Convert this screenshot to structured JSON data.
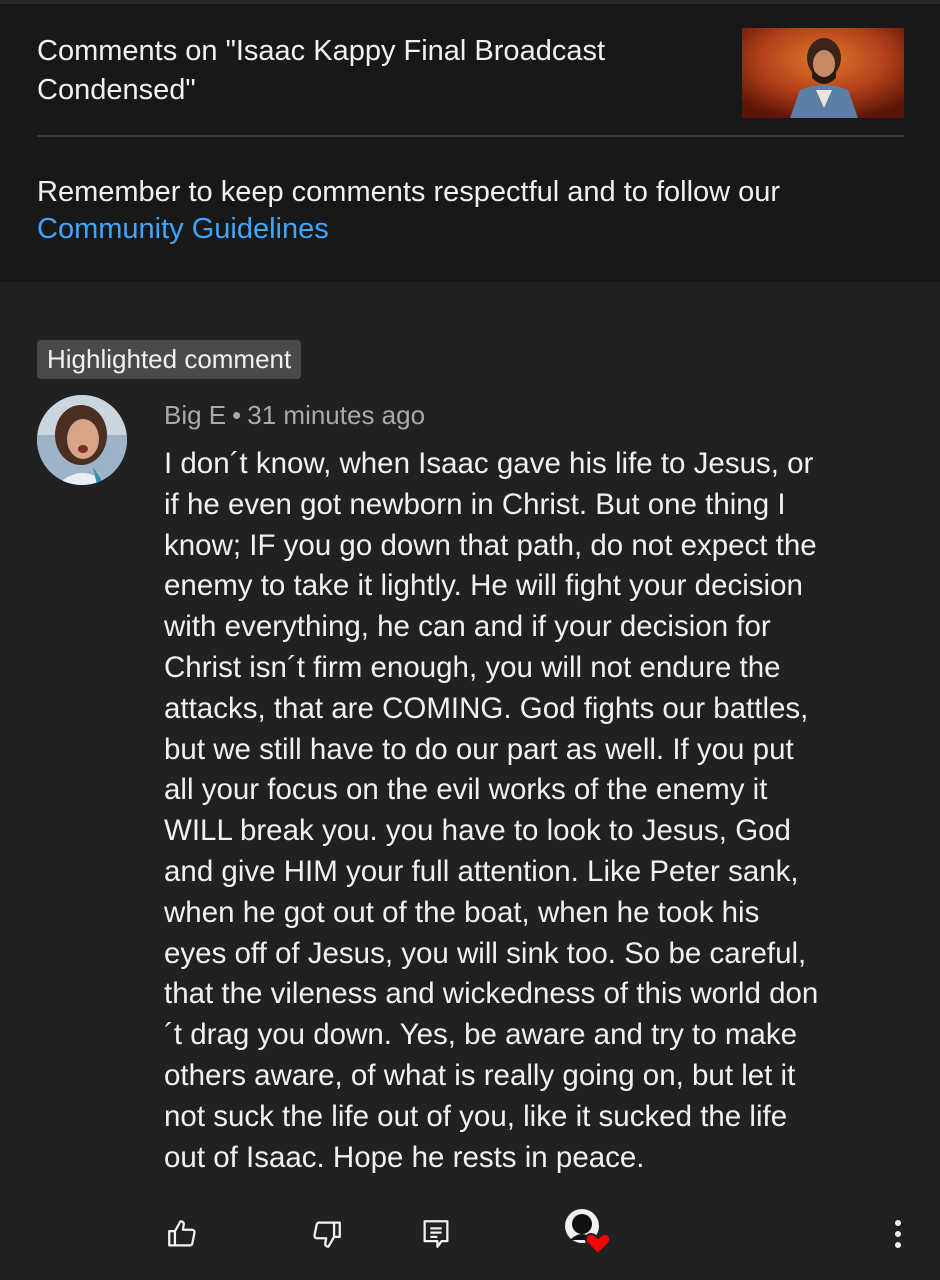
{
  "header": {
    "title": "Comments on \"Isaac Kappy Final Broadcast Condensed\"",
    "reminder_text": "Remember to keep comments respectful and to follow our ",
    "guidelines_link": "Community Guidelines"
  },
  "comment": {
    "badge": "Highlighted comment",
    "author": "Big E",
    "separator": "•",
    "time": "31 minutes ago",
    "text": "I don´t know, when Isaac gave his life to Jesus, or\nif he even got newborn in Christ. But one thing I\nknow; IF you go down that path, do not expect the\nenemy to take it lightly. He will fight your decision\nwith everything, he can and if your decision for\nChrist isn´t firm enough, you will not endure the\nattacks, that are COMING. God fights our battles,\nbut we still have to do our part as well. If you put\nall your focus on the evil works of the enemy it\nWILL break you. you have to look to Jesus, God\nand give HIM your full attention. Like Peter sank,\nwhen he got out of the boat, when he took his\neyes off of Jesus, you will sink too. So be careful,\nthat the vileness and wickedness of this world don\n´t drag you down. Yes, be aware and try to make\nothers aware, of what is really going on, but let it\nnot suck the life out of you, like it sucked the life\nout of Isaac. Hope he rests in peace."
  },
  "actions": {
    "like_icon": "thumbs-up-icon",
    "dislike_icon": "thumbs-down-icon",
    "reply_icon": "reply-icon",
    "creator_heart_icon": "creator-heart-icon",
    "more_icon": "more-vertical-icon"
  },
  "colors": {
    "background": "#212121",
    "header_background": "#181818",
    "link": "#3ea6ff",
    "heart": "#ff0000"
  }
}
